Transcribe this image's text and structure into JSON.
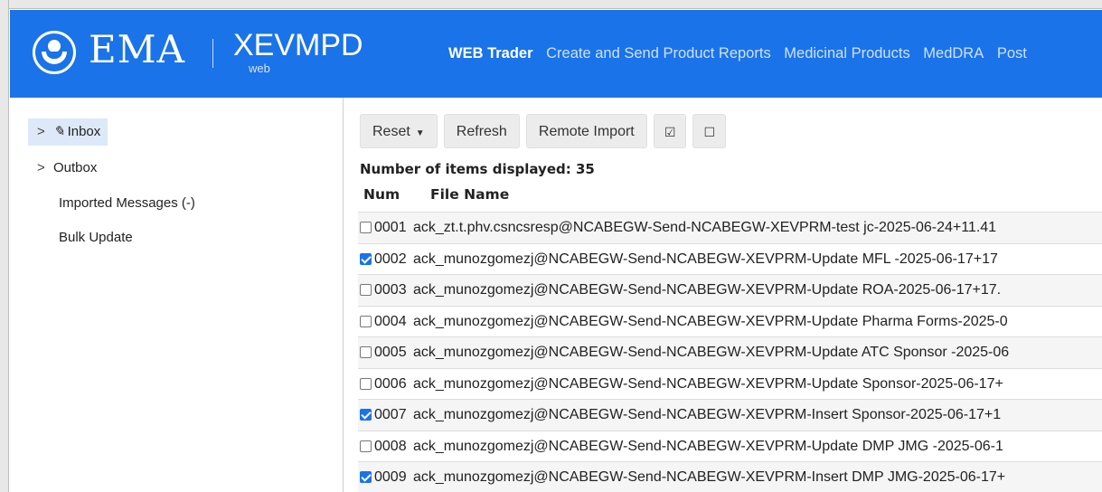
{
  "header": {
    "brand": "EMA",
    "product": "XEVMPD",
    "product_sub": "web",
    "nav": [
      {
        "label": "WEB Trader",
        "active": true
      },
      {
        "label": "Create and Send Product Reports",
        "active": false
      },
      {
        "label": "Medicinal Products",
        "active": false
      },
      {
        "label": "MedDRA",
        "active": false
      },
      {
        "label": "Post",
        "active": false
      }
    ],
    "colors": {
      "bar": "#1a73e8",
      "active_text": "#ffffff",
      "inactive_text": "#cfe0ff"
    }
  },
  "sidebar": {
    "items": [
      {
        "label": "Inbox",
        "selected": true,
        "expandable": true,
        "icon": "pencil-icon"
      },
      {
        "label": "Outbox",
        "selected": false,
        "expandable": true
      },
      {
        "label": "Imported Messages (-)",
        "selected": false,
        "expandable": false
      },
      {
        "label": "Bulk Update",
        "selected": false,
        "expandable": false
      }
    ]
  },
  "toolbar": {
    "reset_label": "Reset",
    "refresh_label": "Refresh",
    "remote_import_label": "Remote Import",
    "select_all_label": "☑",
    "select_none_label": "☐"
  },
  "list": {
    "count_text": "Number of items displayed: 35",
    "columns": [
      "Num",
      "File Name"
    ],
    "rows": [
      {
        "num": "0001",
        "checked": false,
        "file": "ack_zt.t.phv.csncsresp@NCABEGW-Send-NCABEGW-XEVPRM-test jc-2025-06-24+11.41"
      },
      {
        "num": "0002",
        "checked": true,
        "file": "ack_munozgomezj@NCABEGW-Send-NCABEGW-XEVPRM-Update MFL -2025-06-17+17"
      },
      {
        "num": "0003",
        "checked": false,
        "file": "ack_munozgomezj@NCABEGW-Send-NCABEGW-XEVPRM-Update ROA-2025-06-17+17."
      },
      {
        "num": "0004",
        "checked": false,
        "file": "ack_munozgomezj@NCABEGW-Send-NCABEGW-XEVPRM-Update Pharma Forms-2025-0"
      },
      {
        "num": "0005",
        "checked": false,
        "file": "ack_munozgomezj@NCABEGW-Send-NCABEGW-XEVPRM-Update ATC Sponsor -2025-06"
      },
      {
        "num": "0006",
        "checked": false,
        "file": "ack_munozgomezj@NCABEGW-Send-NCABEGW-XEVPRM-Update Sponsor-2025-06-17+"
      },
      {
        "num": "0007",
        "checked": true,
        "file": "ack_munozgomezj@NCABEGW-Send-NCABEGW-XEVPRM-Insert Sponsor-2025-06-17+1"
      },
      {
        "num": "0008",
        "checked": false,
        "file": "ack_munozgomezj@NCABEGW-Send-NCABEGW-XEVPRM-Update DMP JMG -2025-06-1"
      },
      {
        "num": "0009",
        "checked": true,
        "file": "ack_munozgomezj@NCABEGW-Send-NCABEGW-XEVPRM-Insert DMP JMG-2025-06-17+"
      }
    ]
  }
}
